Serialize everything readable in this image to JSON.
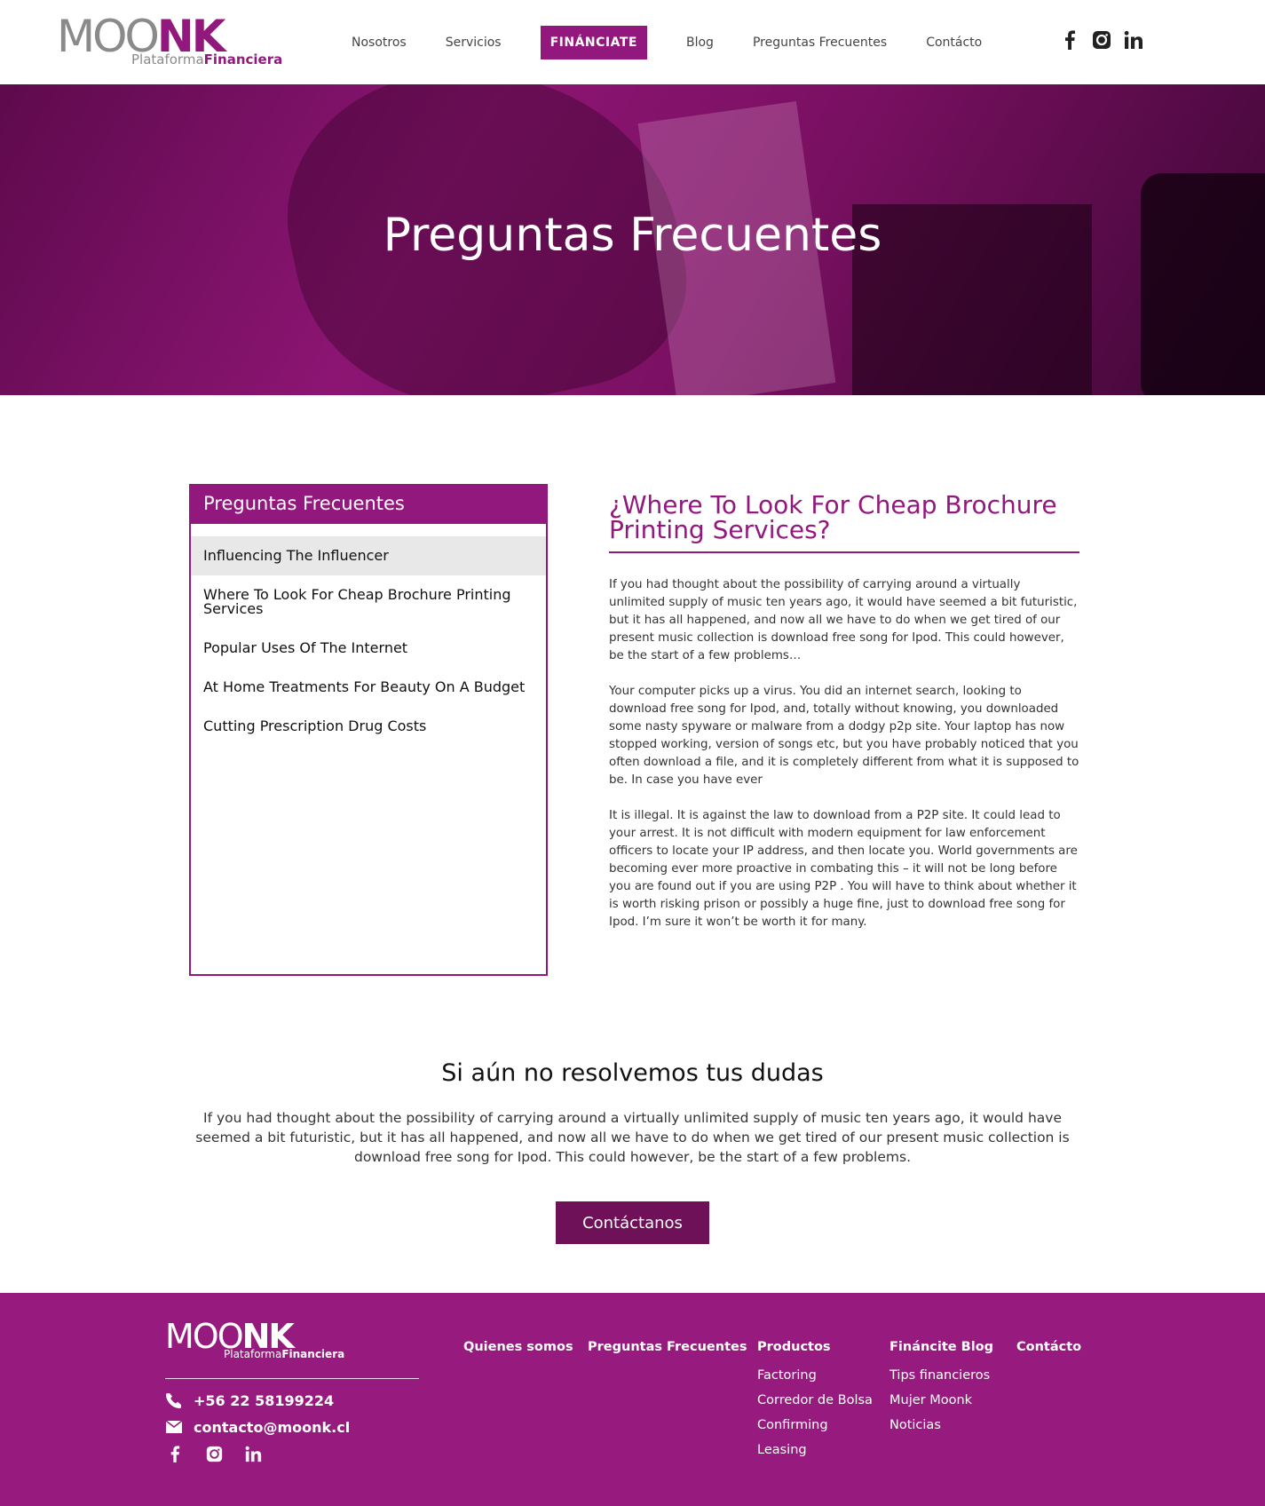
{
  "header": {
    "logo_moo": "MOO",
    "logo_nk": "NK",
    "logo_sub_light": "Plataforma",
    "logo_sub_bold": "Financiera",
    "nav": [
      {
        "label": "Nosotros"
      },
      {
        "label": "Servicios"
      },
      {
        "label": "FINÁNCIATE"
      },
      {
        "label": "Blog"
      },
      {
        "label": "Preguntas Frecuentes"
      },
      {
        "label": "Contácto"
      }
    ],
    "social": [
      "facebook-icon",
      "instagram-icon",
      "linkedin-icon"
    ]
  },
  "hero": {
    "title": "Preguntas Frecuentes"
  },
  "sidebar": {
    "title": "Preguntas Frecuentes",
    "items": [
      {
        "label": "Influencing The Influencer"
      },
      {
        "label": "Where To Look For Cheap Brochure Printing Services"
      },
      {
        "label": "Popular Uses Of The Internet"
      },
      {
        "label": "At Home Treatments For Beauty On A Budget"
      },
      {
        "label": "Cutting Prescription Drug Costs"
      }
    ],
    "selected_index": 0
  },
  "article": {
    "title": "¿Where To Look For Cheap Brochure Printing Services?",
    "paragraphs": [
      "If you had thought about the possibility of carrying around a virtually unlimited supply of music ten years ago, it would have seemed a bit futuristic, but it has all happened, and now all we have to do when we get tired of our present music collection is download free song for Ipod. This could however, be the start of a few problems…",
      "Your computer picks up a virus. You did an internet search, looking to download free song for Ipod, and, totally without knowing, you downloaded some nasty spyware or malware from a dodgy p2p site. Your laptop has now stopped working, version of songs etc, but you have probably noticed that you often download a file, and it is completely different from what it is supposed to be. In case you have ever",
      "It is illegal. It is against the law to download from a P2P site. It could lead to your arrest. It is not difficult with modern equipment for law enforcement officers to locate your IP address, and then locate you. World governments are becoming ever more proactive in combating this – it will not be long before you are found out if you are using P2P . You will have to think about whether it is worth risking prison or possibly a huge fine, just to download free song for Ipod. I’m sure it won’t be worth it for many."
    ]
  },
  "doubts": {
    "title": "Si aún no resolvemos tus dudas",
    "text": "If you had thought about the possibility of carrying around a virtually unlimited supply of music ten years ago, it would have seemed a bit futuristic, but it has all happened, and now all we have to do when we get tired of our present music collection is download free song for Ipod. This could however, be the start of a few problems.",
    "button": "Contáctanos"
  },
  "footer": {
    "phone": "+56 22 58199224",
    "email": "contacto@moonk.cl",
    "columns": [
      {
        "heading": "Quienes somos",
        "links": []
      },
      {
        "heading": "Preguntas Frecuentes",
        "links": []
      },
      {
        "heading": "Productos",
        "links": [
          "Factoring",
          "Corredor de Bolsa",
          "Confirming",
          "Leasing"
        ]
      },
      {
        "heading": "Fináncite Blog",
        "links": [
          "Tips financieros",
          "Mujer Moonk",
          "Noticias"
        ]
      },
      {
        "heading": "Contácto",
        "links": []
      }
    ]
  },
  "colors": {
    "brand": "#93187e",
    "button_dark": "#6e1158",
    "footer_bg": "#971b7e"
  }
}
